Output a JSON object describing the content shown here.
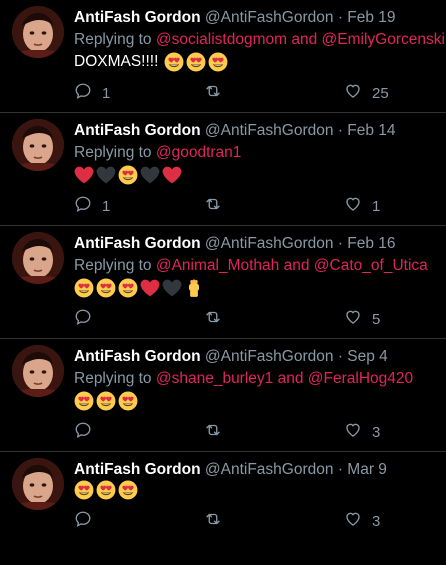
{
  "tweets": [
    {
      "name": "AntiFash Gordon",
      "handle": "@AntiFashGordon",
      "date": "Feb 19",
      "replying_prefix": "Replying to",
      "replying_links": [
        "@socialistdogmom",
        "and",
        "@EmilyGorcenski"
      ],
      "text": "DOXMAS!!!!",
      "emojis": [
        "heart-eyes",
        "heart-eyes",
        "heart-eyes"
      ],
      "reply_count": "1",
      "retweet_count": "",
      "like_count": "25"
    },
    {
      "name": "AntiFash Gordon",
      "handle": "@AntiFashGordon",
      "date": "Feb 14",
      "replying_prefix": "Replying to",
      "replying_links": [
        "@goodtran1"
      ],
      "text": "",
      "emojis": [
        "red-heart",
        "black-heart",
        "heart-eyes",
        "black-heart",
        "red-heart"
      ],
      "reply_count": "1",
      "retweet_count": "",
      "like_count": "1"
    },
    {
      "name": "AntiFash Gordon",
      "handle": "@AntiFashGordon",
      "date": "Feb 16",
      "replying_prefix": "Replying to",
      "replying_links": [
        "@Animal_Mothah",
        "and",
        "@Cato_of_Utica"
      ],
      "text": "",
      "emojis": [
        "heart-eyes",
        "heart-eyes",
        "heart-eyes",
        "red-heart",
        "black-heart",
        "raised-fist"
      ],
      "reply_count": "",
      "retweet_count": "",
      "like_count": "5"
    },
    {
      "name": "AntiFash Gordon",
      "handle": "@AntiFashGordon",
      "date": "Sep 4",
      "replying_prefix": "Replying to",
      "replying_links": [
        "@shane_burley1",
        "and",
        "@FeralHog420"
      ],
      "text": "",
      "emojis": [
        "heart-eyes",
        "heart-eyes",
        "heart-eyes"
      ],
      "reply_count": "",
      "retweet_count": "",
      "like_count": "3"
    },
    {
      "name": "AntiFash Gordon",
      "handle": "@AntiFashGordon",
      "date": "Mar 9",
      "replying_prefix": "",
      "replying_links": [],
      "text": "",
      "emojis": [
        "heart-eyes",
        "heart-eyes",
        "heart-eyes"
      ],
      "reply_count": "",
      "retweet_count": "",
      "like_count": "3"
    }
  ],
  "separator": "·",
  "colors": {
    "background": "#000000",
    "muted": "#8899a6",
    "link": "#e0245e",
    "border": "#2f3336"
  },
  "icons": {
    "reply": "reply-icon",
    "retweet": "retweet-icon",
    "like": "like-icon"
  }
}
